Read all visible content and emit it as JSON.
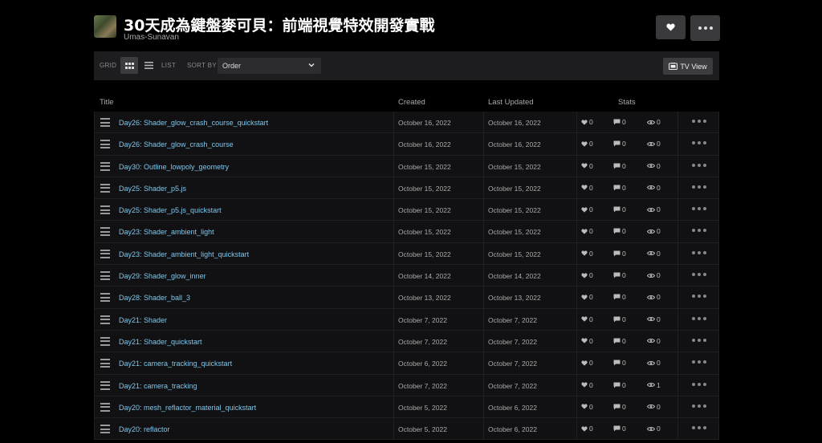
{
  "header": {
    "title": "30天成為鍵盤麥可貝：前端視覺特效開發實戰",
    "author": "Umas-Sunavan",
    "like_icon": "heart-icon",
    "more_icon": "more-dots-icon"
  },
  "toolbar": {
    "grid_label": "GRID",
    "list_label": "LIST",
    "sort_label": "SORT BY",
    "sort_value": "Order",
    "tv_label": "TV View"
  },
  "table": {
    "columns": {
      "title": "Title",
      "created": "Created",
      "updated": "Last Updated",
      "stats": "Stats"
    },
    "rows": [
      {
        "name": "Day26: Shader_glow_crash_course_quickstart",
        "created": "October 16, 2022",
        "updated": "October 16, 2022",
        "likes": "0",
        "comments": "0",
        "views": "0"
      },
      {
        "name": "Day26: Shader_glow_crash_course",
        "created": "October 16, 2022",
        "updated": "October 16, 2022",
        "likes": "0",
        "comments": "0",
        "views": "0"
      },
      {
        "name": "Day30: Outline_lowpoly_geometry",
        "created": "October 15, 2022",
        "updated": "October 15, 2022",
        "likes": "0",
        "comments": "0",
        "views": "0"
      },
      {
        "name": "Day25: Shader_p5.js",
        "created": "October 15, 2022",
        "updated": "October 15, 2022",
        "likes": "0",
        "comments": "0",
        "views": "0"
      },
      {
        "name": "Day25: Shader_p5.js_quickstart",
        "created": "October 15, 2022",
        "updated": "October 15, 2022",
        "likes": "0",
        "comments": "0",
        "views": "0"
      },
      {
        "name": "Day23: Shader_ambient_light",
        "created": "October 15, 2022",
        "updated": "October 15, 2022",
        "likes": "0",
        "comments": "0",
        "views": "0"
      },
      {
        "name": "Day23: Shader_ambient_light_quickstart",
        "created": "October 15, 2022",
        "updated": "October 15, 2022",
        "likes": "0",
        "comments": "0",
        "views": "0"
      },
      {
        "name": "Day29: Shader_glow_inner",
        "created": "October 14, 2022",
        "updated": "October 14, 2022",
        "likes": "0",
        "comments": "0",
        "views": "0"
      },
      {
        "name": "Day28: Shader_ball_3",
        "created": "October 13, 2022",
        "updated": "October 13, 2022",
        "likes": "0",
        "comments": "0",
        "views": "0"
      },
      {
        "name": "Day21: Shader",
        "created": "October 7, 2022",
        "updated": "October 7, 2022",
        "likes": "0",
        "comments": "0",
        "views": "0"
      },
      {
        "name": "Day21: Shader_quickstart",
        "created": "October 7, 2022",
        "updated": "October 7, 2022",
        "likes": "0",
        "comments": "0",
        "views": "0"
      },
      {
        "name": "Day21: camera_tracking_quickstart",
        "created": "October 6, 2022",
        "updated": "October 7, 2022",
        "likes": "0",
        "comments": "0",
        "views": "0"
      },
      {
        "name": "Day21: camera_tracking",
        "created": "October 7, 2022",
        "updated": "October 7, 2022",
        "likes": "0",
        "comments": "0",
        "views": "1"
      },
      {
        "name": "Day20: mesh_reflactor_material_quickstart",
        "created": "October 5, 2022",
        "updated": "October 6, 2022",
        "likes": "0",
        "comments": "0",
        "views": "0"
      },
      {
        "name": "Day20: reflactor",
        "created": "October 5, 2022",
        "updated": "October 6, 2022",
        "likes": "0",
        "comments": "0",
        "views": "0"
      }
    ]
  }
}
